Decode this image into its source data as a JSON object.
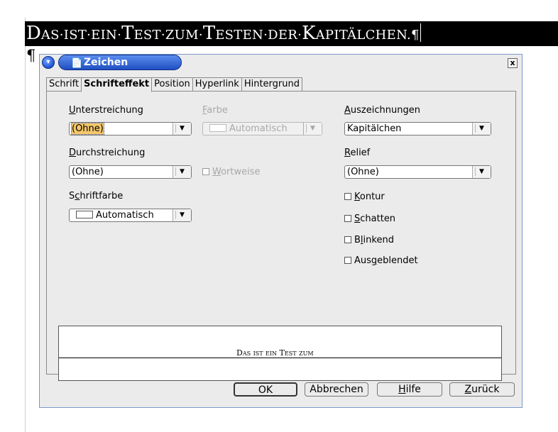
{
  "document": {
    "heading_parts": [
      {
        "text": "D",
        "big": true
      },
      {
        "text": "AS·IST·EIN·",
        "big": false
      },
      {
        "text": "T",
        "big": true
      },
      {
        "text": "EST·ZUM·",
        "big": false
      },
      {
        "text": "T",
        "big": true
      },
      {
        "text": "ESTEN·DER·",
        "big": false
      },
      {
        "text": "K",
        "big": true
      },
      {
        "text": "APITÄLCHEN.¶",
        "big": false
      }
    ],
    "pilcrow": "¶"
  },
  "dialog": {
    "title": "Zeichen",
    "menu_icon": "▾",
    "close_label": "x",
    "tabs": [
      {
        "label": "Schrift",
        "active": false
      },
      {
        "label": "Schrifteffekt",
        "active": true
      },
      {
        "label": "Position",
        "active": false
      },
      {
        "label": "Hyperlink",
        "active": false
      },
      {
        "label": "Hintergrund",
        "active": false
      }
    ],
    "underline": {
      "label_u": "U",
      "label_rest": "nterstreichung",
      "value": "(Ohne)"
    },
    "color": {
      "label_u": "F",
      "label_rest": "arbe",
      "value": "Automatisch"
    },
    "strikethrough": {
      "label_u": "D",
      "label_rest": "urchstreichung",
      "value": "(Ohne)"
    },
    "word_by_word": {
      "label_u": "W",
      "label_rest": "ortweise"
    },
    "font_color": {
      "label_pre": "S",
      "label_u": "c",
      "label_rest": "hriftfarbe",
      "value": "Automatisch"
    },
    "emphasis": {
      "label_u": "A",
      "label_rest": "uszeichnungen",
      "value": "Kapitälchen"
    },
    "relief": {
      "label_u": "R",
      "label_rest": "elief",
      "value": "(Ohne)"
    },
    "checkboxes": {
      "outline": {
        "pre": "",
        "u": "K",
        "rest": "ontur"
      },
      "shadow": {
        "pre": "",
        "u": "S",
        "rest": "chatten"
      },
      "blinking": {
        "pre": "B",
        "u": "l",
        "rest": "inkend"
      },
      "hidden": {
        "pre": "Aus",
        "u": "g",
        "rest": "eblendet"
      }
    },
    "preview_text": "Das ist ein Test zum",
    "buttons": {
      "ok": "OK",
      "cancel": "Abbrechen",
      "help_u": "H",
      "help_rest": "ilfe",
      "reset_u": "Z",
      "reset_rest": "urück"
    }
  }
}
